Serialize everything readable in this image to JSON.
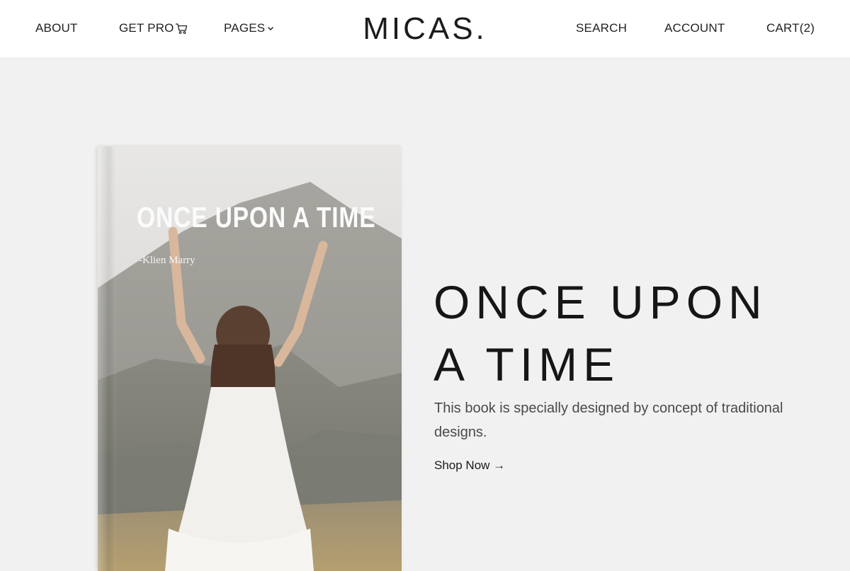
{
  "header": {
    "brand": "MICAS.",
    "nav_left": [
      {
        "label": "ABOUT"
      },
      {
        "label": "GET PRO",
        "icon": "cart-icon"
      },
      {
        "label": "PAGES",
        "icon": "chevron-down-icon"
      }
    ],
    "nav_right": [
      {
        "label": "SEARCH"
      },
      {
        "label": "ACCOUNT"
      },
      {
        "label": "CART(2)"
      }
    ]
  },
  "hero": {
    "book": {
      "cover_title": "ONCE UPON A TIME",
      "author": "-Klien Marry"
    },
    "title_line1": "ONCE UPON",
    "title_line2": "A TIME",
    "description": "This book is specially designed by concept of traditional designs.",
    "cta": "Shop Now →"
  },
  "colors": {
    "background": "#f1f1f1",
    "header_background": "#ffffff",
    "text": "#222222"
  }
}
